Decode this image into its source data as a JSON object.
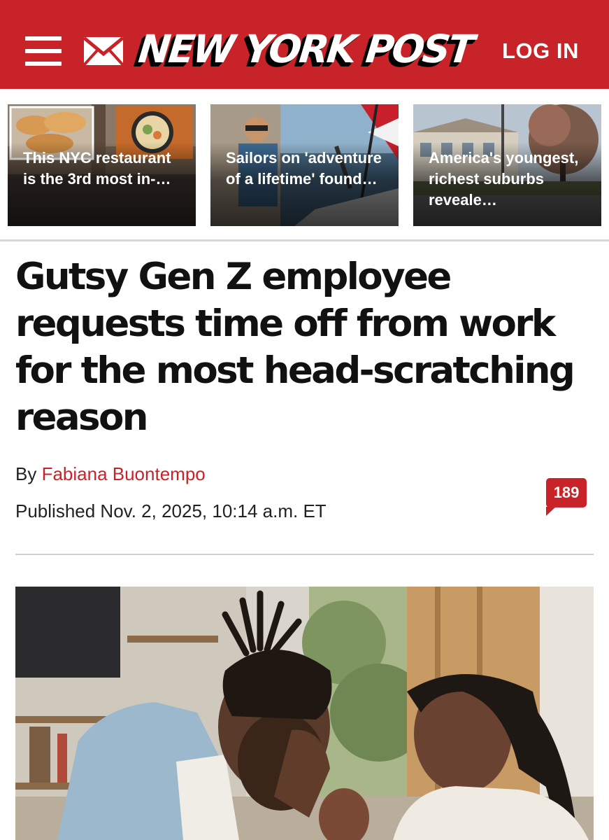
{
  "header": {
    "logo": "NEW YORK POST",
    "login_label": "LOG IN",
    "menu_icon": "hamburger-menu-icon",
    "mail_icon": "envelope-icon",
    "brand_color": "#c9232a"
  },
  "related_stories": [
    {
      "caption": "This NYC restaurant is the 3rd most in-…"
    },
    {
      "caption": "Sailors on 'adventure of a lifetime' found…"
    },
    {
      "caption": "America's youngest, richest suburbs reveale…"
    }
  ],
  "article": {
    "headline": "Gutsy Gen Z employee requests time off from work for the most head-scratching reason",
    "byline_prefix": "By",
    "author": "Fabiana Buontempo",
    "published": "Published Nov. 2, 2025, 10:14 a.m. ET",
    "comment_count": "189"
  }
}
